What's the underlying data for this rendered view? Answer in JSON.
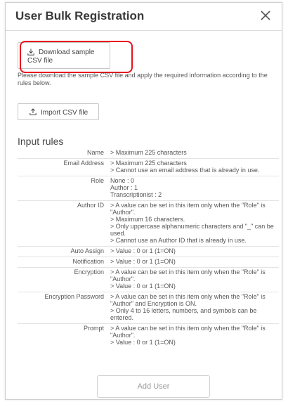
{
  "dialog": {
    "title": "User Bulk Registration"
  },
  "download_button": {
    "label": "Download sample CSV file"
  },
  "instruction": "Please download the sample CSV file and apply the required information according to the rules below.",
  "import_button": {
    "label": "Import CSV file"
  },
  "rules_title": "Input rules",
  "rules": [
    {
      "name": "Name",
      "lines": [
        "> Maximum 225 characters"
      ]
    },
    {
      "name": "Email Address",
      "lines": [
        "> Maximum 225 characters",
        "> Cannot use an email address that is already in use."
      ]
    },
    {
      "name": "Role",
      "lines": [
        "None : 0",
        "Author : 1",
        "Transcriptionist : 2"
      ]
    },
    {
      "name": "Author ID",
      "lines": [
        "> A value can be set in this item only when the \"Role\" is \"Author\".",
        "> Maximum 16 characters.",
        "> Only uppercase alphanumeric characters and \"_\" can be used.",
        "> Cannot use an Author ID that is already in use."
      ]
    },
    {
      "name": "Auto Assign",
      "lines": [
        "> Value : 0 or 1 (1=ON)"
      ]
    },
    {
      "name": "Notification",
      "lines": [
        "> Value : 0 or 1 (1=ON)"
      ]
    },
    {
      "name": "Encryption",
      "lines": [
        "> A value can be set in this item only when the \"Role\" is \"Author\".",
        "> Value : 0 or 1 (1=ON)"
      ]
    },
    {
      "name": "Encryption Password",
      "lines": [
        "> A value can be set in this item only when the \"Role\" is \"Author\" and Encryption is ON.",
        "> Only 4 to 16 letters, numbers, and symbols can be entered."
      ]
    },
    {
      "name": "Prompt",
      "lines": [
        "> A value can be set in this item only when the \"Role\" is \"Author\".",
        "> Value : 0 or 1 (1=ON)"
      ]
    }
  ],
  "add_user_button": {
    "label": "Add User"
  },
  "colors": {
    "highlight": "#e8141e",
    "border": "#c8c8c8",
    "disabled_text": "#9a9a9a"
  },
  "icons": {
    "close": "close-icon",
    "download": "download-icon",
    "upload": "upload-icon"
  }
}
